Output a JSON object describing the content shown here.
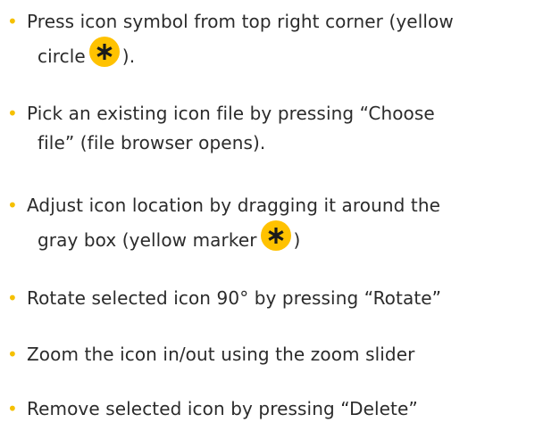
{
  "bullet_glyph": "•",
  "marker_icon": "asterisk-icon",
  "colors": {
    "bullet": "#f5c000",
    "marker_fill": "#ffc200",
    "text": "#2b2b2b"
  },
  "items": [
    {
      "line1": "Press icon symbol from top right corner (yellow",
      "line2_before": "circle",
      "line2_after": ")."
    },
    {
      "line1": "Pick an existing icon file by pressing “Choose",
      "line2": "file” (file browser opens)."
    },
    {
      "line1": "Adjust icon location by dragging it around the",
      "line2_before": "gray box (yellow marker",
      "line2_after": ")"
    },
    {
      "line1": "Rotate selected icon 90° by pressing “Rotate”"
    },
    {
      "line1": "Zoom the icon in/out using the zoom slider"
    },
    {
      "line1": "Remove selected icon by pressing “Delete”"
    }
  ]
}
